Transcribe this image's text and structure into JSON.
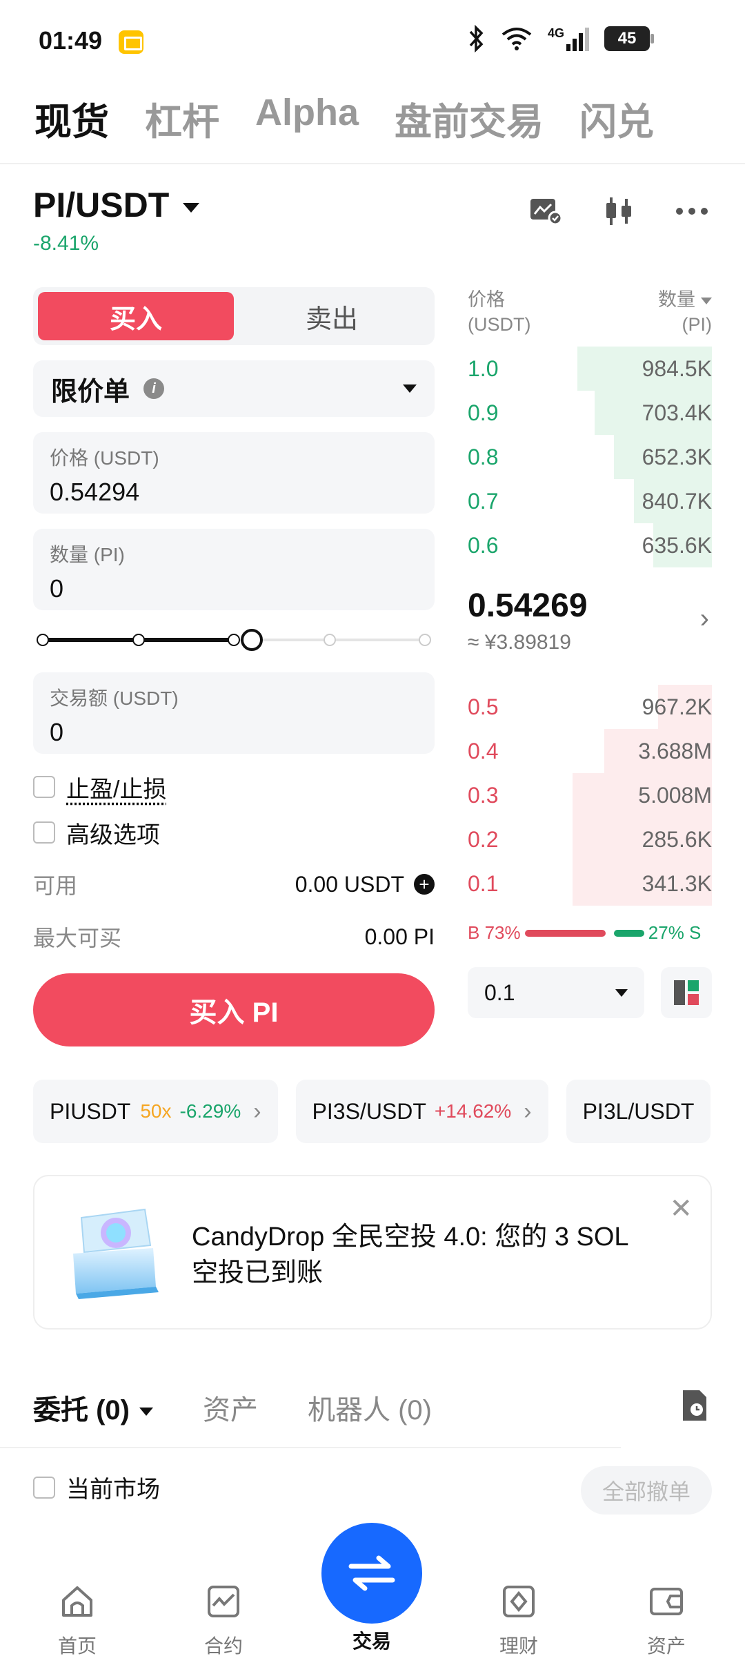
{
  "status": {
    "time": "01:49",
    "network": "4G",
    "battery": "45"
  },
  "top_tabs": [
    "现货",
    "杠杆",
    "Alpha",
    "盘前交易",
    "闪兑"
  ],
  "pair": {
    "symbol": "PI/USDT",
    "change": "-8.41%"
  },
  "trade": {
    "buy_label": "买入",
    "sell_label": "卖出",
    "order_type": "限价单",
    "price_label": "价格 (USDT)",
    "price_value": "0.54294",
    "qty_label": "数量 (PI)",
    "qty_value": "0",
    "slider_percent": 50,
    "amount_label": "交易额 (USDT)",
    "amount_value": "0",
    "tpsl_label": "止盈/止损",
    "advanced_label": "高级选项",
    "available_label": "可用",
    "available_value": "0.00 USDT",
    "max_buy_label": "最大可买",
    "max_buy_value": "0.00 PI",
    "submit_label": "买入 PI"
  },
  "orderbook": {
    "price_header": "价格",
    "price_unit": "(USDT)",
    "qty_header": "数量",
    "qty_unit": "(PI)",
    "asks": [
      {
        "price": "1.0",
        "qty": "984.5K",
        "depth": 0.55
      },
      {
        "price": "0.9",
        "qty": "703.4K",
        "depth": 0.48
      },
      {
        "price": "0.8",
        "qty": "652.3K",
        "depth": 0.4
      },
      {
        "price": "0.7",
        "qty": "840.7K",
        "depth": 0.32
      },
      {
        "price": "0.6",
        "qty": "635.6K",
        "depth": 0.24
      }
    ],
    "last_price": "0.54269",
    "last_price_cny": "≈ ¥3.89819",
    "bids": [
      {
        "price": "0.5",
        "qty": "967.2K",
        "depth": 0.22
      },
      {
        "price": "0.4",
        "qty": "3.688M",
        "depth": 0.44
      },
      {
        "price": "0.3",
        "qty": "5.008M",
        "depth": 0.57
      },
      {
        "price": "0.2",
        "qty": "285.6K",
        "depth": 0.57
      },
      {
        "price": "0.1",
        "qty": "341.3K",
        "depth": 0.57
      }
    ],
    "buy_ratio": "B 73%",
    "sell_ratio": "27% S",
    "buy_pct": 73,
    "depth_step": "0.1"
  },
  "tickers": [
    {
      "symbol": "PIUSDT",
      "lev": "50x",
      "change": "-6.29%",
      "dir": "down"
    },
    {
      "symbol": "PI3S/USDT",
      "lev": "",
      "change": "+14.62%",
      "dir": "up"
    },
    {
      "symbol": "PI3L/USDT",
      "lev": "",
      "change": "",
      "dir": ""
    }
  ],
  "banner": {
    "text": "CandyDrop 全民空投 4.0: 您的 3 SOL 空投已到账"
  },
  "orders": {
    "tab_orders": "委托 (0)",
    "tab_assets": "资产",
    "tab_bots": "机器人 (0)",
    "current_market": "当前市场",
    "cancel_all": "全部撤单"
  },
  "nav": {
    "home": "首页",
    "futures": "合约",
    "trade": "交易",
    "earn": "理财",
    "assets": "资产"
  },
  "colors": {
    "buy": "#f24b5f",
    "sell_green": "#1aa56b",
    "accent_blue": "#1769ff"
  }
}
